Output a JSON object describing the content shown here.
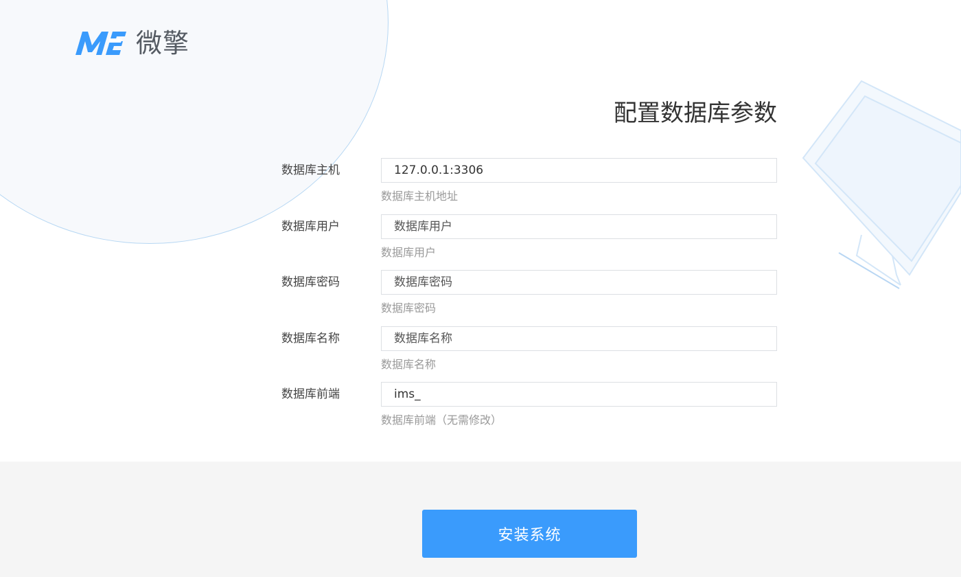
{
  "brand": {
    "logo_mark": "ME",
    "name": "微擎",
    "color": "#3a9bfc"
  },
  "page": {
    "title": "配置数据库参数"
  },
  "form": {
    "fields": [
      {
        "label": "数据库主机",
        "value": "127.0.0.1:3306",
        "placeholder": "",
        "help": "数据库主机地址"
      },
      {
        "label": "数据库用户",
        "value": "",
        "placeholder": "数据库用户",
        "help": "数据库用户"
      },
      {
        "label": "数据库密码",
        "value": "",
        "placeholder": "数据库密码",
        "help": "数据库密码"
      },
      {
        "label": "数据库名称",
        "value": "",
        "placeholder": "数据库名称",
        "help": "数据库名称"
      },
      {
        "label": "数据库前端",
        "value": "ims_",
        "placeholder": "",
        "help": "数据库前端（无需修改）"
      }
    ]
  },
  "footer": {
    "install_label": "安装系统"
  },
  "decorations": {
    "circle_icon": "background-circle",
    "monitor_icon": "monitor-illustration"
  }
}
